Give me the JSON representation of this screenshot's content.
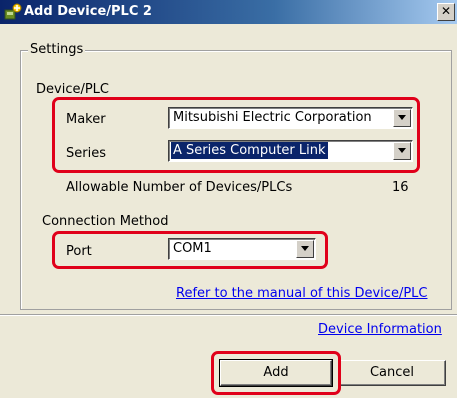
{
  "window": {
    "title": "Add Device/PLC 2",
    "close_label": "✕"
  },
  "settings": {
    "legend": "Settings",
    "device_plc": {
      "legend": "Device/PLC",
      "maker_label": "Maker",
      "maker_value": "Mitsubishi Electric Corporation",
      "series_label": "Series",
      "series_value": "A Series Computer Link",
      "allowable_label": "Allowable Number of Devices/PLCs",
      "allowable_value": "16"
    },
    "connection": {
      "legend": "Connection Method",
      "port_label": "Port",
      "port_value": "COM1"
    },
    "manual_link": "Refer to the manual of this Device/PLC"
  },
  "device_info_link": "Device Information",
  "buttons": {
    "add": "Add",
    "cancel": "Cancel"
  },
  "colors": {
    "highlight": "#e0001a",
    "titlebar": "#0a246a",
    "link": "#0000ee",
    "dialog_bg": "#ece9d8"
  }
}
